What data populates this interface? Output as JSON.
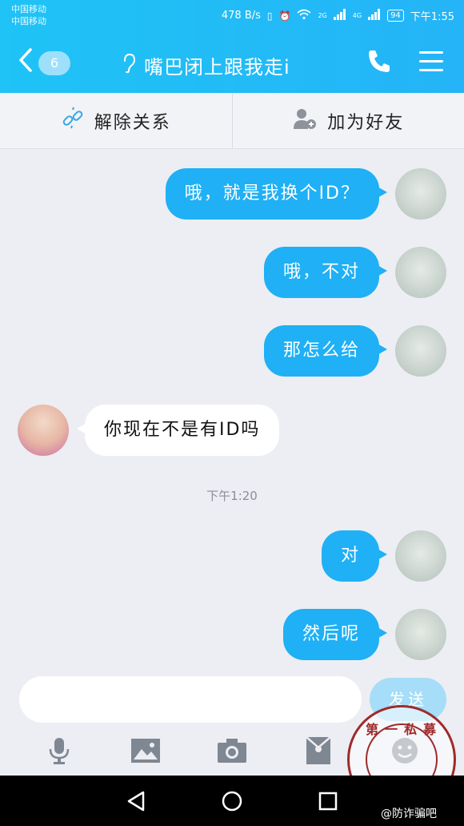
{
  "status_bar": {
    "carrier_1": "中国移动",
    "carrier_2": "中国移动",
    "speed": "478 B/s",
    "net_1": "2G",
    "net_2": "4G",
    "battery": "94",
    "time": "下午1:55"
  },
  "header": {
    "unread_count": "6",
    "title": "嘴巴闭上跟我走i",
    "accent_color": "#1fb0f5"
  },
  "relation_bar": {
    "unlink_label": "解除关系",
    "add_friend_label": "加为好友"
  },
  "messages": [
    {
      "sender": "self",
      "text": "哦，就是我换个ID？"
    },
    {
      "sender": "self",
      "text": "哦，不对"
    },
    {
      "sender": "self",
      "text": "那怎么给"
    },
    {
      "sender": "other",
      "text": "你现在不是有ID吗"
    },
    {
      "sender": "self",
      "text": "对"
    },
    {
      "sender": "self",
      "text": "然后呢"
    }
  ],
  "timestamp": "下午1:20",
  "input": {
    "placeholder": "",
    "send_label": "发送"
  },
  "toolbar_icons": [
    "microphone-icon",
    "image-icon",
    "camera-icon",
    "red-packet-icon",
    "emoji-icon"
  ],
  "watermark": {
    "seal_text": "第一私募",
    "caption": "@防诈骗吧"
  }
}
